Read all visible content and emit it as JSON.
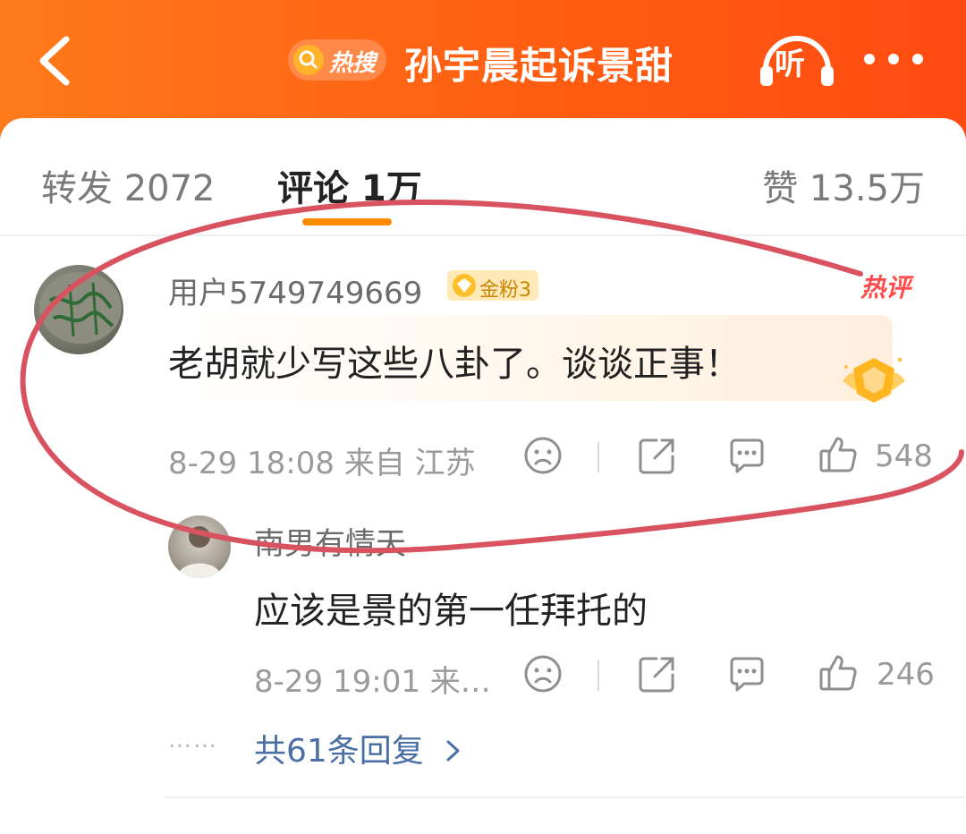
{
  "header": {
    "back_icon": "chevron-left-icon",
    "hot_search_badge": "热搜",
    "title": "孙宇晨起诉景甜",
    "listen_label": "听",
    "more_icon": "more-dots-icon",
    "gradient_start": "#ff7a1a",
    "gradient_end": "#ff4b12"
  },
  "tabs": {
    "repost": "转发 2072",
    "comments": "评论 1万",
    "likes": "赞 13.5万",
    "active": "comments",
    "accent": "#ff8c00"
  },
  "comment": {
    "username": "用户5749749669",
    "fan_badge": "金粉3",
    "hot_tag": "热评",
    "text": "老胡就少写这些八卦了。谈谈正事！",
    "meta": "8-29 18:08 来自 江苏",
    "like_count": "548"
  },
  "reply": {
    "username": "南男有情天",
    "text": "应该是景的第一任拜托的",
    "meta": "8-29 19:01 来…",
    "like_count": "246"
  },
  "more_replies": "共61条回复",
  "dots": "……",
  "colors": {
    "annotation_stroke": "#d8535f",
    "link": "#4a6fa5",
    "hot_tag": "#ff4d4d"
  }
}
